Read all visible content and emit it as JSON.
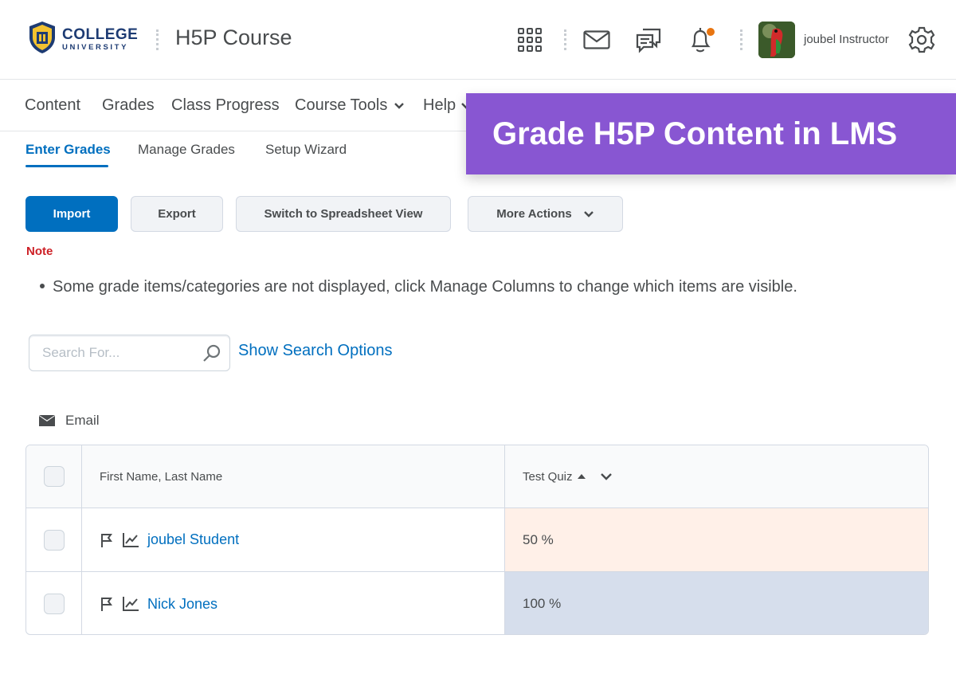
{
  "header": {
    "logo_line1": "COLLEGE",
    "logo_line2": "UNIVERSITY",
    "course_title": "H5P Course",
    "user_name": "joubel Instructor",
    "icons": [
      "apps-grid-icon",
      "mail-icon",
      "chat-icon",
      "bell-icon",
      "gear-icon"
    ],
    "notification_color": "#e87511"
  },
  "nav": {
    "items": [
      {
        "label": "Content"
      },
      {
        "label": "Grades"
      },
      {
        "label": "Class Progress"
      },
      {
        "label": "Course Tools"
      },
      {
        "label": "Help"
      }
    ]
  },
  "banner": {
    "text": "Grade H5P Content in LMS",
    "color": "#8856d2"
  },
  "tabs": [
    {
      "label": "Enter Grades",
      "active": true
    },
    {
      "label": "Manage Grades",
      "active": false
    },
    {
      "label": "Setup Wizard",
      "active": false
    }
  ],
  "actions": {
    "import": "Import",
    "export": "Export",
    "spreadsheet": "Switch to Spreadsheet View",
    "more": "More Actions"
  },
  "note": {
    "title": "Note",
    "text": "Some grade items/categories are not displayed, click Manage Columns to change which items are visible."
  },
  "search": {
    "placeholder": "Search For...",
    "options_link": "Show Search Options"
  },
  "email_label": "Email",
  "table": {
    "headers": {
      "name": "First Name, Last Name",
      "quiz": "Test Quiz"
    },
    "rows": [
      {
        "name": "joubel Student",
        "grade": "50 %"
      },
      {
        "name": "Nick Jones",
        "grade": "100 %"
      }
    ]
  },
  "colors": {
    "accent": "#006fbf",
    "note_red": "#cd2026",
    "grade_low_bg": "#fff0e8",
    "grade_high_bg": "#d6deec"
  }
}
